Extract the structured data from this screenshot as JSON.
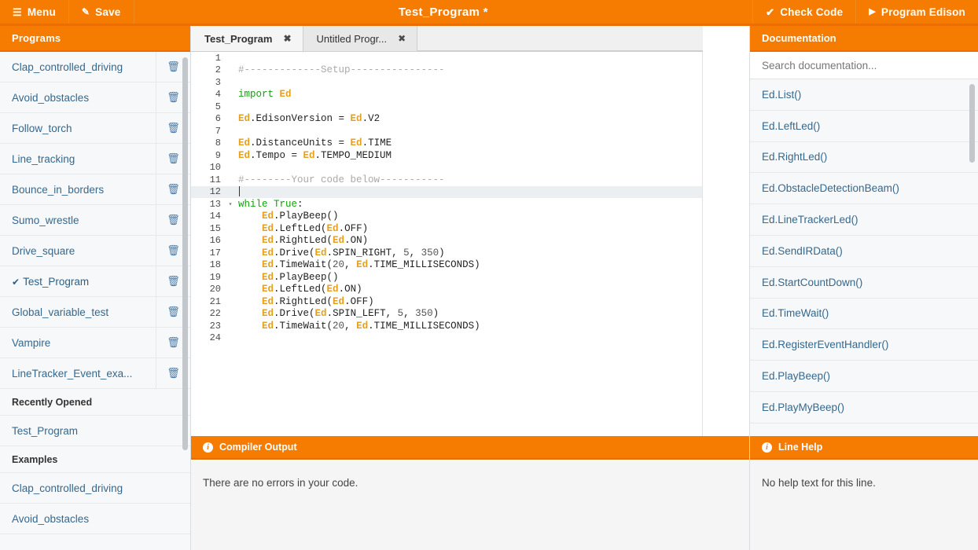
{
  "topbar": {
    "menu_label": "Menu",
    "save_label": "Save",
    "title": "Test_Program *",
    "check_code_label": "Check Code",
    "program_edison_label": "Program Edison",
    "accent_color": "#f57c00",
    "accent_dark": "#ef6c00"
  },
  "sidebar": {
    "header": "Programs",
    "programs": [
      {
        "name": "Clap_controlled_driving",
        "current": false
      },
      {
        "name": "Avoid_obstacles",
        "current": false
      },
      {
        "name": "Follow_torch",
        "current": false
      },
      {
        "name": "Line_tracking",
        "current": false
      },
      {
        "name": "Bounce_in_borders",
        "current": false
      },
      {
        "name": "Sumo_wrestle",
        "current": false
      },
      {
        "name": "Drive_square",
        "current": false
      },
      {
        "name": "Test_Program",
        "current": true
      },
      {
        "name": "Global_variable_test",
        "current": false
      },
      {
        "name": "Vampire",
        "current": false
      },
      {
        "name": "LineTracker_Event_exa...",
        "current": false
      }
    ],
    "recently_opened_header": "Recently Opened",
    "recently_opened": [
      "Test_Program"
    ],
    "examples_header": "Examples",
    "examples": [
      "Clap_controlled_driving",
      "Avoid_obstacles"
    ]
  },
  "tabs": [
    {
      "label": "Test_Program",
      "active": true
    },
    {
      "label": "Untitled Progr...",
      "active": false
    }
  ],
  "editor": {
    "active_line": 12,
    "lines": [
      {
        "n": 1,
        "fold": "",
        "tokens": []
      },
      {
        "n": 2,
        "fold": "",
        "tokens": [
          {
            "t": "cmt",
            "v": "#-------------Setup----------------"
          }
        ]
      },
      {
        "n": 3,
        "fold": "",
        "tokens": []
      },
      {
        "n": 4,
        "fold": "",
        "tokens": [
          {
            "t": "kw",
            "v": "import "
          },
          {
            "t": "ed",
            "v": "Ed"
          }
        ]
      },
      {
        "n": 5,
        "fold": "",
        "tokens": []
      },
      {
        "n": 6,
        "fold": "",
        "tokens": [
          {
            "t": "ed",
            "v": "Ed"
          },
          {
            "t": "pln",
            "v": ".EdisonVersion = "
          },
          {
            "t": "ed",
            "v": "Ed"
          },
          {
            "t": "pln",
            "v": ".V2"
          }
        ]
      },
      {
        "n": 7,
        "fold": "",
        "tokens": []
      },
      {
        "n": 8,
        "fold": "",
        "tokens": [
          {
            "t": "ed",
            "v": "Ed"
          },
          {
            "t": "pln",
            "v": ".DistanceUnits = "
          },
          {
            "t": "ed",
            "v": "Ed"
          },
          {
            "t": "pln",
            "v": ".TIME"
          }
        ]
      },
      {
        "n": 9,
        "fold": "",
        "tokens": [
          {
            "t": "ed",
            "v": "Ed"
          },
          {
            "t": "pln",
            "v": ".Tempo = "
          },
          {
            "t": "ed",
            "v": "Ed"
          },
          {
            "t": "pln",
            "v": ".TEMPO_MEDIUM"
          }
        ]
      },
      {
        "n": 10,
        "fold": "",
        "tokens": []
      },
      {
        "n": 11,
        "fold": "",
        "tokens": [
          {
            "t": "cmt",
            "v": "#--------Your code below-----------"
          }
        ]
      },
      {
        "n": 12,
        "fold": "",
        "tokens": [],
        "caret": true
      },
      {
        "n": 13,
        "fold": "▾",
        "tokens": [
          {
            "t": "kw",
            "v": "while True"
          },
          {
            "t": "pln",
            "v": ":"
          }
        ]
      },
      {
        "n": 14,
        "fold": "",
        "tokens": [
          {
            "t": "pln",
            "v": "    "
          },
          {
            "t": "ed",
            "v": "Ed"
          },
          {
            "t": "pln",
            "v": ".PlayBeep()"
          }
        ]
      },
      {
        "n": 15,
        "fold": "",
        "tokens": [
          {
            "t": "pln",
            "v": "    "
          },
          {
            "t": "ed",
            "v": "Ed"
          },
          {
            "t": "pln",
            "v": ".LeftLed("
          },
          {
            "t": "ed",
            "v": "Ed"
          },
          {
            "t": "pln",
            "v": ".OFF)"
          }
        ]
      },
      {
        "n": 16,
        "fold": "",
        "tokens": [
          {
            "t": "pln",
            "v": "    "
          },
          {
            "t": "ed",
            "v": "Ed"
          },
          {
            "t": "pln",
            "v": ".RightLed("
          },
          {
            "t": "ed",
            "v": "Ed"
          },
          {
            "t": "pln",
            "v": ".ON)"
          }
        ]
      },
      {
        "n": 17,
        "fold": "",
        "tokens": [
          {
            "t": "pln",
            "v": "    "
          },
          {
            "t": "ed",
            "v": "Ed"
          },
          {
            "t": "pln",
            "v": ".Drive("
          },
          {
            "t": "ed",
            "v": "Ed"
          },
          {
            "t": "pln",
            "v": ".SPIN_RIGHT, "
          },
          {
            "t": "num",
            "v": "5"
          },
          {
            "t": "pln",
            "v": ", "
          },
          {
            "t": "num",
            "v": "350"
          },
          {
            "t": "pln",
            "v": ")"
          }
        ]
      },
      {
        "n": 18,
        "fold": "",
        "tokens": [
          {
            "t": "pln",
            "v": "    "
          },
          {
            "t": "ed",
            "v": "Ed"
          },
          {
            "t": "pln",
            "v": ".TimeWait("
          },
          {
            "t": "num",
            "v": "20"
          },
          {
            "t": "pln",
            "v": ", "
          },
          {
            "t": "ed",
            "v": "Ed"
          },
          {
            "t": "pln",
            "v": ".TIME_MILLISECONDS)"
          }
        ]
      },
      {
        "n": 19,
        "fold": "",
        "tokens": [
          {
            "t": "pln",
            "v": "    "
          },
          {
            "t": "ed",
            "v": "Ed"
          },
          {
            "t": "pln",
            "v": ".PlayBeep()"
          }
        ]
      },
      {
        "n": 20,
        "fold": "",
        "tokens": [
          {
            "t": "pln",
            "v": "    "
          },
          {
            "t": "ed",
            "v": "Ed"
          },
          {
            "t": "pln",
            "v": ".LeftLed("
          },
          {
            "t": "ed",
            "v": "Ed"
          },
          {
            "t": "pln",
            "v": ".ON)"
          }
        ]
      },
      {
        "n": 21,
        "fold": "",
        "tokens": [
          {
            "t": "pln",
            "v": "    "
          },
          {
            "t": "ed",
            "v": "Ed"
          },
          {
            "t": "pln",
            "v": ".RightLed("
          },
          {
            "t": "ed",
            "v": "Ed"
          },
          {
            "t": "pln",
            "v": ".OFF)"
          }
        ]
      },
      {
        "n": 22,
        "fold": "",
        "tokens": [
          {
            "t": "pln",
            "v": "    "
          },
          {
            "t": "ed",
            "v": "Ed"
          },
          {
            "t": "pln",
            "v": ".Drive("
          },
          {
            "t": "ed",
            "v": "Ed"
          },
          {
            "t": "pln",
            "v": ".SPIN_LEFT, "
          },
          {
            "t": "num",
            "v": "5"
          },
          {
            "t": "pln",
            "v": ", "
          },
          {
            "t": "num",
            "v": "350"
          },
          {
            "t": "pln",
            "v": ")"
          }
        ]
      },
      {
        "n": 23,
        "fold": "",
        "tokens": [
          {
            "t": "pln",
            "v": "    "
          },
          {
            "t": "ed",
            "v": "Ed"
          },
          {
            "t": "pln",
            "v": ".TimeWait("
          },
          {
            "t": "num",
            "v": "20"
          },
          {
            "t": "pln",
            "v": ", "
          },
          {
            "t": "ed",
            "v": "Ed"
          },
          {
            "t": "pln",
            "v": ".TIME_MILLISECONDS)"
          }
        ]
      },
      {
        "n": 24,
        "fold": "",
        "tokens": []
      }
    ]
  },
  "compiler": {
    "header": "Compiler Output",
    "message": "There are no errors in your code."
  },
  "documentation": {
    "header": "Documentation",
    "search_placeholder": "Search documentation...",
    "search_value": "",
    "items": [
      "Ed.List()",
      "Ed.LeftLed()",
      "Ed.RightLed()",
      "Ed.ObstacleDetectionBeam()",
      "Ed.LineTrackerLed()",
      "Ed.SendIRData()",
      "Ed.StartCountDown()",
      "Ed.TimeWait()",
      "Ed.RegisterEventHandler()",
      "Ed.PlayBeep()",
      "Ed.PlayMyBeep()"
    ]
  },
  "line_help": {
    "header": "Line Help",
    "message": "No help text for this line."
  }
}
